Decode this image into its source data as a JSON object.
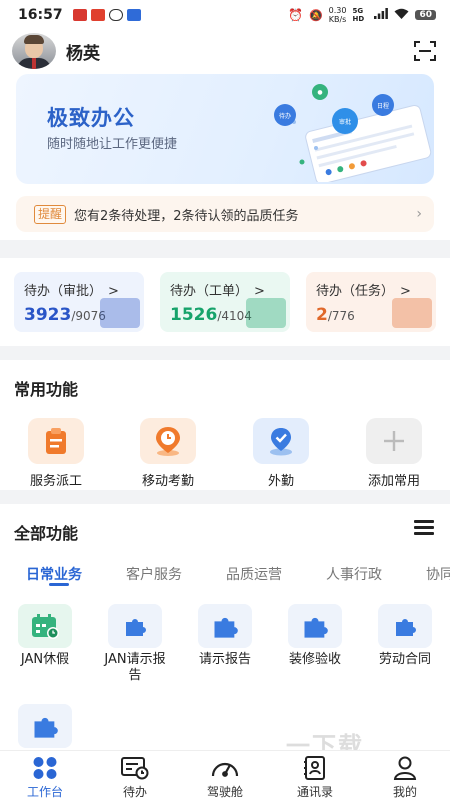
{
  "status_bar": {
    "time": "16:57",
    "speed_value": "0.30",
    "speed_unit": "KB/s",
    "network": "5G HD",
    "battery": "60"
  },
  "header": {
    "username": "杨英"
  },
  "banner": {
    "title": "极致办公",
    "subtitle": "随时随地让工作更便捷",
    "bubble_labels": [
      "待办",
      "审批",
      "日程"
    ]
  },
  "notice": {
    "tag": "提醒",
    "text": "您有2条待处理，2条待认领的品质任务"
  },
  "todo": {
    "cards": [
      {
        "label": "待办（审批）",
        "count": "3923",
        "total": "/9076",
        "color": "#2a55c7",
        "bg": "#eef3fd"
      },
      {
        "label": "待办（工单）",
        "count": "1526",
        "total": "/4104",
        "color": "#17a36b",
        "bg": "#eaf8f2"
      },
      {
        "label": "待办（任务）",
        "count": "2",
        "total": "/776",
        "color": "#e0682a",
        "bg": "#fdf1ea"
      }
    ],
    "arrow": ">"
  },
  "common": {
    "title": "常用功能",
    "items": [
      {
        "label": "服务派工",
        "icon": "clipboard-icon"
      },
      {
        "label": "移动考勤",
        "icon": "location-clock-icon"
      },
      {
        "label": "外勤",
        "icon": "location-pin-icon"
      },
      {
        "label": "添加常用",
        "icon": "plus-icon"
      }
    ]
  },
  "all_functions": {
    "title": "全部功能",
    "tabs": [
      "日常业务",
      "客户服务",
      "品质运营",
      "人事行政",
      "协同"
    ],
    "apps": [
      {
        "label": "JAN休假",
        "icon": "calendar-icon"
      },
      {
        "label": "JAN请示报告",
        "icon": "puzzle-icon"
      },
      {
        "label": "请示报告",
        "icon": "puzzle-icon"
      },
      {
        "label": "装修验收",
        "icon": "puzzle-icon"
      },
      {
        "label": "劳动合同",
        "icon": "puzzle-icon"
      },
      {
        "label": "",
        "icon": "puzzle-icon"
      }
    ]
  },
  "nav": {
    "items": [
      {
        "label": "工作台",
        "icon": "grid-icon"
      },
      {
        "label": "待办",
        "icon": "todo-icon"
      },
      {
        "label": "驾驶舱",
        "icon": "speedometer-icon"
      },
      {
        "label": "通讯录",
        "icon": "contacts-icon"
      },
      {
        "label": "我的",
        "icon": "user-icon"
      }
    ]
  },
  "watermark": "一下载"
}
